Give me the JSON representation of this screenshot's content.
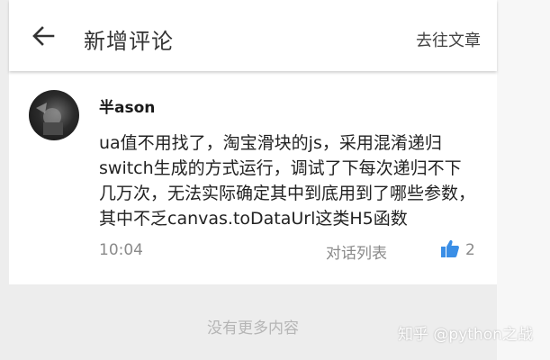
{
  "appbar": {
    "title": "新增评论",
    "goto_article": "去往文章"
  },
  "comment": {
    "author": "半ason",
    "lines": [
      "ua值不用找了，淘宝滑块的js，采用混淆递归",
      "switch生成的方式运行，调试了下每次递归不下",
      "几万次，无法实际确定其中到底用到了哪些参数，",
      "其中不乏canvas.toDataUrl这类H5函数"
    ],
    "time": "10:04",
    "thread_link": "对话列表",
    "like_count": "2"
  },
  "footer": {
    "no_more": "没有更多内容"
  },
  "watermark": "知乎 @python之战",
  "colors": {
    "like_blue": "#3a8ee6",
    "text_dark": "#222222",
    "text_muted": "#8a8a8a"
  }
}
